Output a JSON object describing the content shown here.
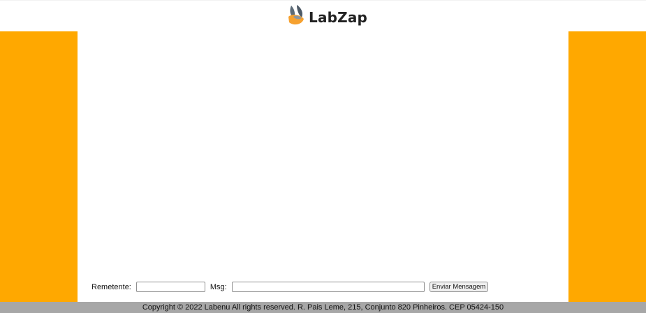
{
  "header": {
    "logo_text": "LabZap",
    "logo_icon": "leaf-logo-icon"
  },
  "colors": {
    "side_panel": "#ffa800",
    "footer_bg": "#a7a7a7",
    "logo_dark": "#5d6b77",
    "logo_orange": "#f6a12f"
  },
  "composer": {
    "sender_label": "Remetente:",
    "sender_value": "",
    "message_label": "Msg:",
    "message_value": "",
    "send_label": "Enviar Mensagem"
  },
  "footer": {
    "text": "Copyright © 2022 Labenu All rights reserved. R. Pais Leme, 215, Conjunto 820 Pinheiros. CEP 05424-150"
  }
}
